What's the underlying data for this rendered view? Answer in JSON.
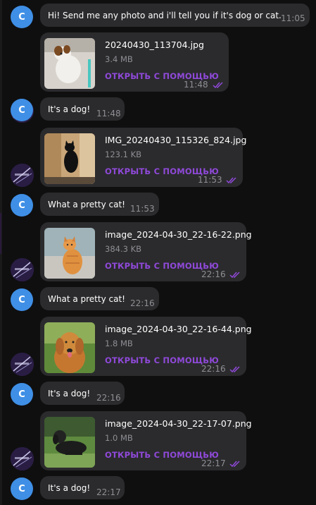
{
  "messages": [
    {
      "type": "text",
      "avatar": "C",
      "text": "Hi! Send me any photo and i'll tell you if it's dog or cat.",
      "time": "11:05"
    },
    {
      "type": "file",
      "file_name": "20240430_113704.jpg",
      "file_size": "3.4 MB",
      "open_label": "ОТКРЫТЬ С ПОМОЩЬЮ",
      "time": "11:48",
      "thumb": "dog-white-brown"
    },
    {
      "type": "text",
      "avatar": "C",
      "text": "It's a dog!",
      "time": "11:48"
    },
    {
      "type": "file",
      "file_name": "IMG_20240430_115326_824.jpg",
      "file_size": "123.1 KB",
      "open_label": "ОТКРЫТЬ С ПОМОЩЬЮ",
      "time": "11:53",
      "thumb": "cat-black"
    },
    {
      "type": "text",
      "avatar": "C",
      "text": "What a pretty cat!",
      "time": "11:53"
    },
    {
      "type": "file",
      "file_name": "image_2024-04-30_22-16-22.png",
      "file_size": "384.3 KB",
      "open_label": "ОТКРЫТЬ С ПОМОЩЬЮ",
      "time": "22:16",
      "thumb": "cat-orange"
    },
    {
      "type": "text",
      "avatar": "C",
      "text": "What a pretty cat!",
      "time": "22:16"
    },
    {
      "type": "file",
      "file_name": "image_2024-04-30_22-16-44.png",
      "file_size": "1.8 MB",
      "open_label": "ОТКРЫТЬ С ПОМОЩЬЮ",
      "time": "22:16",
      "thumb": "dog-golden"
    },
    {
      "type": "text",
      "avatar": "C",
      "text": "It's a dog!",
      "time": "22:16"
    },
    {
      "type": "file",
      "file_name": "image_2024-04-30_22-17-07.png",
      "file_size": "1.0 MB",
      "open_label": "ОТКРЫТЬ С ПОМОЩЬЮ",
      "time": "22:17",
      "thumb": "dog-black"
    },
    {
      "type": "text",
      "avatar": "C",
      "text": "It's a dog!",
      "time": "22:17"
    }
  ],
  "colors": {
    "background": "#0f0f10",
    "bubble": "#2b2b2d",
    "accent": "#8f49d9",
    "bot_avatar": "#3f8fe6",
    "time": "#8e8f94"
  },
  "icons": {
    "read_status": "double-check-icon"
  }
}
